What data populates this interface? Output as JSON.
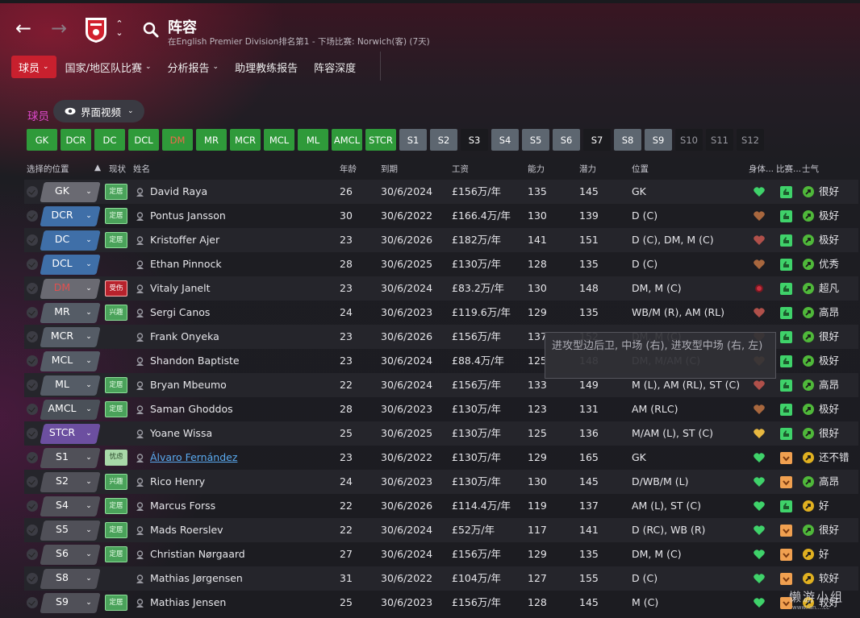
{
  "header": {
    "title": "阵容",
    "subtitle": "在English Premier Division排名第1 - 下场比赛: Norwich(客) (7天)",
    "nav_back": "←",
    "nav_forward": "→"
  },
  "menu": [
    {
      "label": "球员",
      "has_caret": true,
      "active": true
    },
    {
      "label": "国家/地区队比赛",
      "has_caret": true,
      "active": false
    },
    {
      "label": "分析报告",
      "has_caret": true,
      "active": false
    },
    {
      "label": "助理教练报告",
      "has_caret": false,
      "active": false
    },
    {
      "label": "阵容深度",
      "has_caret": false,
      "active": false
    }
  ],
  "section_label": "球员",
  "view_button": {
    "label": "界面视频"
  },
  "position_chips": [
    {
      "label": "GK",
      "style": "green"
    },
    {
      "label": "DCR",
      "style": "green"
    },
    {
      "label": "DC",
      "style": "green"
    },
    {
      "label": "DCL",
      "style": "green"
    },
    {
      "label": "DM",
      "style": "green-dm"
    },
    {
      "label": "MR",
      "style": "green"
    },
    {
      "label": "MCR",
      "style": "green"
    },
    {
      "label": "MCL",
      "style": "green"
    },
    {
      "label": "ML",
      "style": "green"
    },
    {
      "label": "AMCL",
      "style": "green"
    },
    {
      "label": "STCR",
      "style": "green"
    },
    {
      "label": "S1",
      "style": "grey"
    },
    {
      "label": "S2",
      "style": "grey"
    },
    {
      "label": "S3",
      "style": "dark"
    },
    {
      "label": "S4",
      "style": "grey"
    },
    {
      "label": "S5",
      "style": "grey"
    },
    {
      "label": "S6",
      "style": "grey"
    },
    {
      "label": "S7",
      "style": "dark"
    },
    {
      "label": "S8",
      "style": "grey"
    },
    {
      "label": "S9",
      "style": "grey"
    },
    {
      "label": "S10",
      "style": "darkdim"
    },
    {
      "label": "S11",
      "style": "darkdim"
    },
    {
      "label": "S12",
      "style": "darkdim"
    }
  ],
  "columns": {
    "selected_position": "选择的位置",
    "status": "现状",
    "name": "姓名",
    "age": "年龄",
    "expires": "到期",
    "wage": "工资",
    "ability": "能力",
    "potential": "潜力",
    "position": "位置",
    "condition": "身体...",
    "match": "比赛...",
    "morale": "士气"
  },
  "colors": {
    "gk": "#6a6a72",
    "defence": "#3f6fa8",
    "dm": "#6a6a72",
    "midfield": "#555c66",
    "amc": "#4a5058",
    "striker": "#6c4fa0",
    "sub": "#505058",
    "badge_green": "#4aa25a",
    "badge_red": "#b8222c",
    "morale_green": "#4fb83a",
    "morale_yellow": "#e0b020"
  },
  "players": [
    {
      "pos": "GK",
      "pos_color": "gk",
      "status": "定居",
      "status_color": "green",
      "name": "David Raya",
      "age": "26",
      "expires": "30/6/2024",
      "wage": "£156万/年",
      "ca": "135",
      "pa": "145",
      "position": "GK",
      "cond": "green",
      "match": "green",
      "morale_color": "green",
      "morale": "很好",
      "link": false
    },
    {
      "pos": "DCR",
      "pos_color": "defence",
      "status": "定居",
      "status_color": "green",
      "name": "Pontus Jansson",
      "age": "30",
      "expires": "30/6/2022",
      "wage": "£166.4万/年",
      "ca": "130",
      "pa": "139",
      "position": "D (C)",
      "cond": "brown",
      "match": "green",
      "morale_color": "green",
      "morale": "极好",
      "link": false
    },
    {
      "pos": "DC",
      "pos_color": "defence",
      "status": "定居",
      "status_color": "green",
      "name": "Kristoffer Ajer",
      "age": "23",
      "expires": "30/6/2026",
      "wage": "£182万/年",
      "ca": "141",
      "pa": "151",
      "position": "D (C), DM, M (C)",
      "cond": "brownred",
      "match": "green",
      "morale_color": "green",
      "morale": "极好",
      "link": false
    },
    {
      "pos": "DCL",
      "pos_color": "defence",
      "status": "",
      "status_color": "none",
      "name": "Ethan Pinnock",
      "age": "28",
      "expires": "30/6/2025",
      "wage": "£130万/年",
      "ca": "128",
      "pa": "135",
      "position": "D (C)",
      "cond": "brown",
      "match": "green",
      "morale_color": "green",
      "morale": "优秀",
      "link": false
    },
    {
      "pos": "DM",
      "pos_color": "dm",
      "status": "受伤",
      "status_color": "red",
      "name": "Vitaly Janelt",
      "age": "23",
      "expires": "30/6/2024",
      "wage": "£83.2万/年",
      "ca": "130",
      "pa": "148",
      "position": "DM, M (C)",
      "cond": "injured",
      "match": "green",
      "morale_color": "green",
      "morale": "超凡",
      "link": false
    },
    {
      "pos": "MR",
      "pos_color": "midfield",
      "status": "兴趣",
      "status_color": "green",
      "name": "Sergi Canos",
      "age": "24",
      "expires": "30/6/2023",
      "wage": "£119.6万/年",
      "ca": "129",
      "pa": "135",
      "position": "WB/M (R), AM (RL)",
      "cond": "brownred",
      "match": "green",
      "morale_color": "green",
      "morale": "高昂",
      "link": false
    },
    {
      "pos": "MCR",
      "pos_color": "midfield",
      "status": "",
      "status_color": "none",
      "name": "Frank Onyeka",
      "age": "23",
      "expires": "30/6/2026",
      "wage": "£156万/年",
      "ca": "137",
      "pa": "152",
      "position": "DM, M (C)",
      "cond": "brown",
      "match": "green",
      "morale_color": "green",
      "morale": "很好",
      "link": false
    },
    {
      "pos": "MCL",
      "pos_color": "midfield",
      "status": "",
      "status_color": "none",
      "name": "Shandon Baptiste",
      "age": "23",
      "expires": "30/6/2024",
      "wage": "£88.4万/年",
      "ca": "125",
      "pa": "148",
      "position": "DM, M/AM (C)",
      "cond": "orange",
      "match": "green",
      "morale_color": "green",
      "morale": "极好",
      "link": false
    },
    {
      "pos": "ML",
      "pos_color": "midfield",
      "status": "定居",
      "status_color": "green",
      "name": "Bryan Mbeumo",
      "age": "22",
      "expires": "30/6/2024",
      "wage": "£156万/年",
      "ca": "133",
      "pa": "149",
      "position": "M (L), AM (RL), ST (C)",
      "cond": "brownred",
      "match": "green",
      "morale_color": "green",
      "morale": "高昂",
      "link": false
    },
    {
      "pos": "AMCL",
      "pos_color": "amc",
      "status": "定居",
      "status_color": "green",
      "name": "Saman Ghoddos",
      "age": "28",
      "expires": "30/6/2023",
      "wage": "£130万/年",
      "ca": "123",
      "pa": "131",
      "position": "AM (RLC)",
      "cond": "brown",
      "match": "green",
      "morale_color": "green",
      "morale": "极好",
      "link": false
    },
    {
      "pos": "STCR",
      "pos_color": "striker",
      "status": "",
      "status_color": "none",
      "name": "Yoane Wissa",
      "age": "25",
      "expires": "30/6/2025",
      "wage": "£130万/年",
      "ca": "125",
      "pa": "136",
      "position": "M/AM (L), ST (C)",
      "cond": "yellow",
      "match": "green",
      "morale_color": "green",
      "morale": "很好",
      "link": false
    },
    {
      "pos": "S1",
      "pos_color": "sub",
      "status": "忧虑",
      "status_color": "lightgreen",
      "name": "Álvaro Fernández",
      "age": "23",
      "expires": "30/6/2022",
      "wage": "£130万/年",
      "ca": "129",
      "pa": "165",
      "position": "GK",
      "cond": "green",
      "match": "orange",
      "morale_color": "yellow",
      "morale": "还不错",
      "link": true
    },
    {
      "pos": "S2",
      "pos_color": "sub",
      "status": "兴趣",
      "status_color": "green",
      "name": "Rico Henry",
      "age": "24",
      "expires": "30/6/2023",
      "wage": "£130万/年",
      "ca": "130",
      "pa": "145",
      "position": "D/WB/M (L)",
      "cond": "green",
      "match": "orange",
      "morale_color": "green",
      "morale": "高昂",
      "link": false
    },
    {
      "pos": "S4",
      "pos_color": "sub",
      "status": "定居",
      "status_color": "green",
      "name": "Marcus Forss",
      "age": "22",
      "expires": "30/6/2026",
      "wage": "£114.4万/年",
      "ca": "119",
      "pa": "137",
      "position": "AM (L), ST (C)",
      "cond": "green",
      "match": "green",
      "morale_color": "yellow",
      "morale": "好",
      "link": false
    },
    {
      "pos": "S5",
      "pos_color": "sub",
      "status": "定居",
      "status_color": "green",
      "name": "Mads Roerslev",
      "age": "22",
      "expires": "30/6/2024",
      "wage": "£52万/年",
      "ca": "117",
      "pa": "141",
      "position": "D (RC), WB (R)",
      "cond": "green",
      "match": "orange",
      "morale_color": "green",
      "morale": "很好",
      "link": false
    },
    {
      "pos": "S6",
      "pos_color": "sub",
      "status": "定居",
      "status_color": "green",
      "name": "Christian Nørgaard",
      "age": "27",
      "expires": "30/6/2024",
      "wage": "£156万/年",
      "ca": "129",
      "pa": "135",
      "position": "DM, M (C)",
      "cond": "green",
      "match": "orange",
      "morale_color": "yellow",
      "morale": "好",
      "link": false
    },
    {
      "pos": "S8",
      "pos_color": "sub",
      "status": "",
      "status_color": "none",
      "name": "Mathias Jørgensen",
      "age": "31",
      "expires": "30/6/2022",
      "wage": "£104万/年",
      "ca": "127",
      "pa": "155",
      "position": "D (C)",
      "cond": "green",
      "match": "orange",
      "morale_color": "yellow",
      "morale": "较好",
      "link": false
    },
    {
      "pos": "S9",
      "pos_color": "sub",
      "status": "定居",
      "status_color": "green",
      "name": "Mathias Jensen",
      "age": "25",
      "expires": "30/6/2023",
      "wage": "£156万/年",
      "ca": "128",
      "pa": "145",
      "position": "M (C)",
      "cond": "green",
      "match": "orange",
      "morale_color": "yellow",
      "morale": "较好",
      "link": false
    }
  ],
  "tooltip": {
    "text": "进攻型边后卫, 中场 (右), 进攻型中场 (右, 左)"
  },
  "watermark": {
    "text": "懒游小组",
    "sub": "www.lan....cc"
  }
}
